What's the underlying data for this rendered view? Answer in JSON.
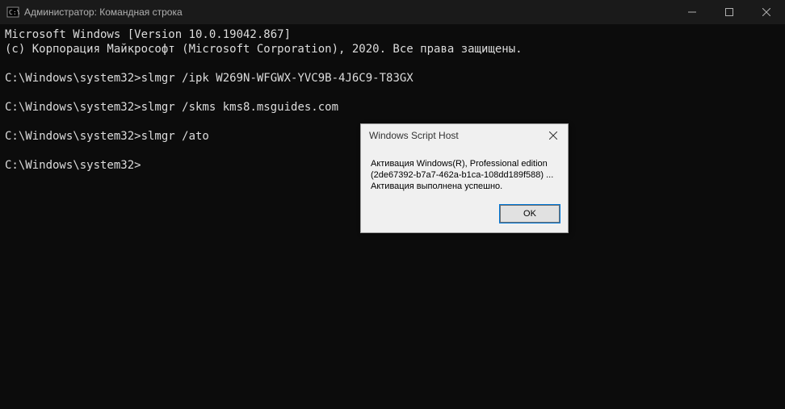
{
  "titlebar": {
    "title": "Администратор: Командная строка"
  },
  "terminal": {
    "version_line": "Microsoft Windows [Version 10.0.19042.867]",
    "copyright_line": "(c) Корпорация Майкрософт (Microsoft Corporation), 2020. Все права защищены.",
    "prompt": "C:\\Windows\\system32>",
    "cmd1": "slmgr /ipk W269N-WFGWX-YVC9B-4J6C9-T83GX",
    "cmd2": "slmgr /skms kms8.msguides.com",
    "cmd3": "slmgr /ato"
  },
  "dialog": {
    "title": "Windows Script Host",
    "line1": "Активация Windows(R), Professional edition",
    "line2": "(2de67392-b7a7-462a-b1ca-108dd189f588) ...",
    "line3": "Активация выполнена успешно.",
    "ok_label": "OK"
  }
}
